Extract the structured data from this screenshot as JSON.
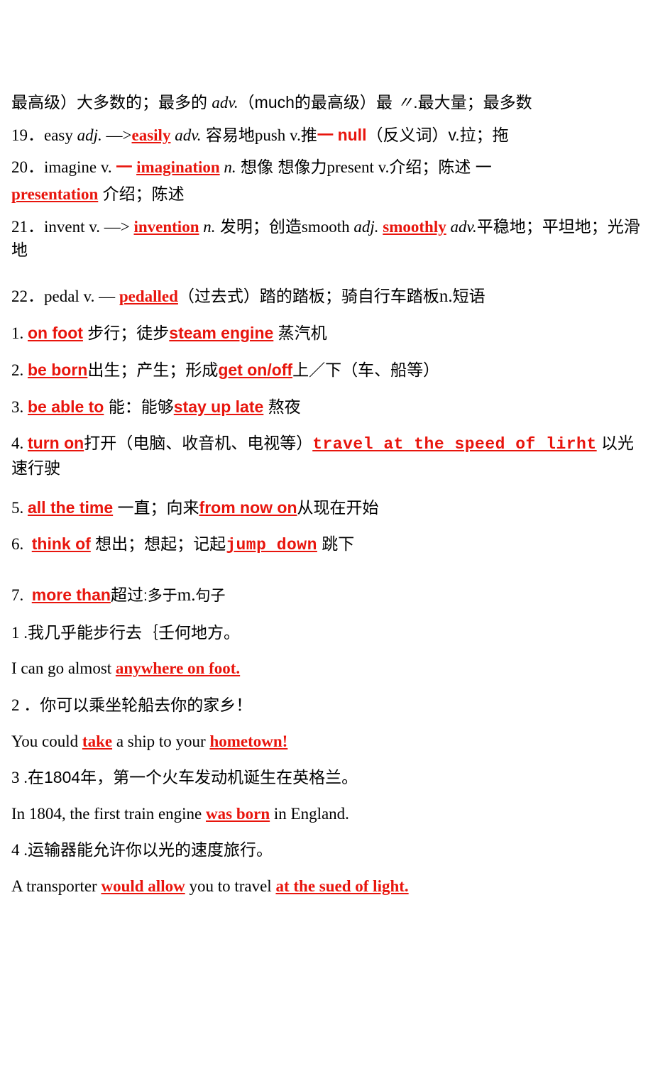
{
  "document": {
    "lines": {
      "l0_a": "最高级）大多数的；最多的 ",
      "l0_b": "adv.",
      "l0_c": "（much的最高级）最 ",
      "l0_d": "〃",
      "l0_e": ".最大量；最多数",
      "l19_num": "19．",
      "l19_a": "easy ",
      "l19_b": "adj.",
      "l19_c": " —>",
      "l19_d": "easily",
      "l19_e": " adv.",
      "l19_f": " 容易地",
      "l19_g": "push v.",
      "l19_h": "推",
      "l19_i": "一",
      "l19_j": "null",
      "l19_k": "（反义词）v.拉；拖",
      "l20_num": "20．",
      "l20_a": "imagine v. ",
      "l20_b": "一",
      "l20_c": "imagination",
      "l20_d": " n.",
      "l20_e": " 想像  想像力",
      "l20_f": "present v.",
      "l20_g": "介绍；陈述 ",
      "l20_h": "一",
      "l20_i": "presentation",
      "l20_j": " 介绍；陈述",
      "l21_num": "21．",
      "l21_a": "invent v. —> ",
      "l21_b": "invention",
      "l21_c": " n.",
      "l21_d": " 发明；创造",
      "l21_e": "smooth ",
      "l21_f": "adj.",
      "l21_g": " ",
      "l21_h": "smoothly",
      "l21_i": " adv.",
      "l21_j": "平稳地；平坦地；光滑地",
      "l22_num": "22．",
      "l22_a": "pedal v. — ",
      "l22_b": "pedalled",
      "l22_c": "（过去式）踏的踏板；骑自行车踏板",
      "l22_d": "n.",
      "l22_e": "短语",
      "p1_num": "1.",
      "p1_a": "on foot",
      "p1_b": " 步行；徒步",
      "p1_c": "steam engine",
      "p1_d": " 蒸汽机",
      "p2_num": "2.",
      "p2_a": "be born",
      "p2_b": "出生；产生；形成",
      "p2_c": "get on/off",
      "p2_d": "上／下（车、船等）",
      "p3_num": "3.",
      "p3_a": "be able to",
      "p3_b": " 能：能够",
      "p3_c": "stay up late",
      "p3_d": " 熬夜",
      "p4_num": "4.",
      "p4_a": "turn on",
      "p4_b": "打开（电脑、收音机、电视等）",
      "p4_c": "travel at the speed of lirht",
      "p4_d": " 以光速行驶",
      "p5_num": "5.",
      "p5_a": "all the time",
      "p5_b": " 一直；向来",
      "p5_c": "from now on",
      "p5_d": "从现在开始",
      "p6_num": "6.",
      "p6_a": "think of",
      "p6_b": " 想出；想起；记起",
      "p6_c": "jump down",
      "p6_d": " 跳下",
      "p7_num": "7.",
      "p7_a": "more than",
      "p7_b": "超过",
      "p7_c": ":多于",
      "p7_d": "m.",
      "p7_e": "句子",
      "s1_num": "1 .",
      "s1_cn": "我几乎能步行去｛壬何地方。",
      "s1_en_a": "I can go almost ",
      "s1_en_b": "anywhere on foot.",
      "s2_num": "2 ．",
      "s2_cn": "你可以乘坐轮船去你的家乡！",
      "s2_en_a": "You could ",
      "s2_en_b": "take",
      "s2_en_c": " a ship to your ",
      "s2_en_d": "hometown!",
      "s3_num": "3 .",
      "s3_cn": "在1804年，第一个火车发动机诞生在英格兰。",
      "s3_en_a": "In 1804, the first train engine ",
      "s3_en_b": "was born",
      "s3_en_c": " in England.",
      "s4_num": "4 .",
      "s4_cn": "运输器能允许你以光的速度旅行。",
      "s4_en_a": "A transporter ",
      "s4_en_b": "would allow",
      "s4_en_c": " you to travel ",
      "s4_en_d": "at the sued of light."
    },
    "colors": {
      "highlight": "#e8150d",
      "text": "#000000",
      "background": "#ffffff"
    }
  }
}
